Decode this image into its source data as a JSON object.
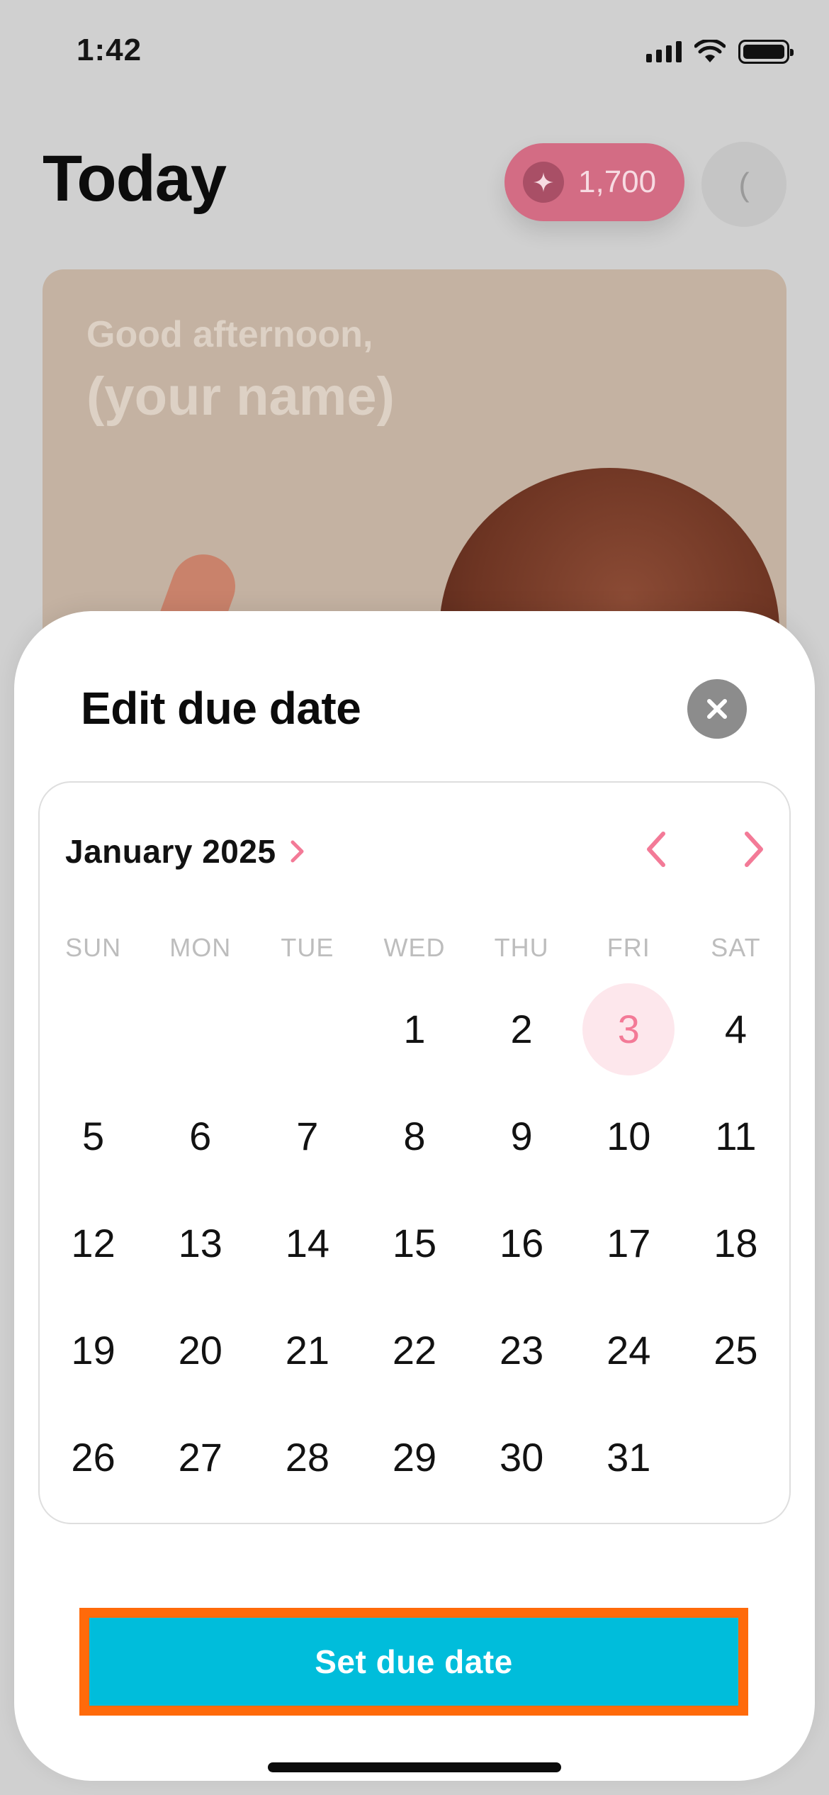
{
  "status_bar": {
    "time": "1:42"
  },
  "header": {
    "title": "Today",
    "points": "1,700",
    "avatar_initial": "("
  },
  "hero": {
    "greeting": "Good afternoon,",
    "name": "(your name)"
  },
  "sheet": {
    "title": "Edit due date",
    "calendar": {
      "month_label": "January 2025",
      "weekdays": [
        "SUN",
        "MON",
        "TUE",
        "WED",
        "THU",
        "FRI",
        "SAT"
      ],
      "weeks": [
        [
          "",
          "",
          "",
          "1",
          "2",
          "3",
          "4"
        ],
        [
          "5",
          "6",
          "7",
          "8",
          "9",
          "10",
          "11"
        ],
        [
          "12",
          "13",
          "14",
          "15",
          "16",
          "17",
          "18"
        ],
        [
          "19",
          "20",
          "21",
          "22",
          "23",
          "24",
          "25"
        ],
        [
          "26",
          "27",
          "28",
          "29",
          "30",
          "31",
          ""
        ]
      ],
      "selected_day": "3"
    },
    "cta_label": "Set due date"
  },
  "colors": {
    "accent_pink": "#f37a97",
    "selected_bg": "#fde7ec",
    "cta_blue": "#00bddb",
    "cta_highlight": "#ff6a0a"
  },
  "icons": {
    "close": "close-icon",
    "prev": "chevron-left-icon",
    "next": "chevron-right-icon",
    "points": "sparkle-icon"
  }
}
